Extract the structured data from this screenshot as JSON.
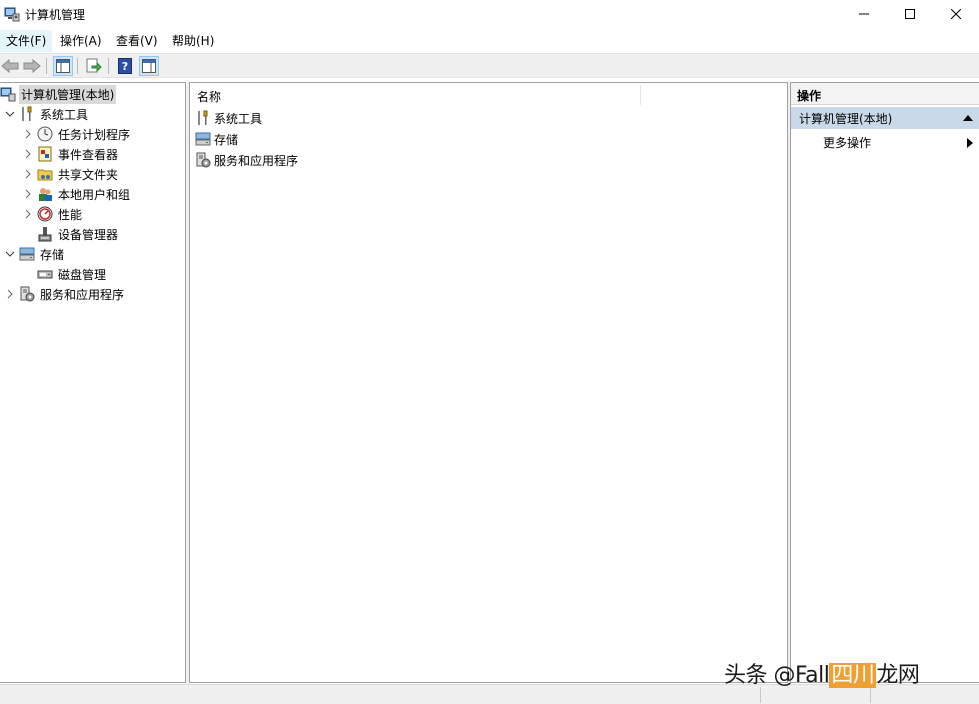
{
  "window": {
    "title": "计算机管理",
    "icon": "computer-management-icon"
  },
  "menu": [
    {
      "label": "文件(F)"
    },
    {
      "label": "操作(A)"
    },
    {
      "label": "查看(V)"
    },
    {
      "label": "帮助(H)"
    }
  ],
  "toolbar": {
    "buttons": [
      "back-icon",
      "forward-icon",
      "show-hide-tree-icon",
      "export-icon",
      "help-icon",
      "show-hide-action-pane-icon"
    ]
  },
  "tree": {
    "root": "计算机管理(本地)",
    "items": [
      {
        "label": "系统工具",
        "icon": "tools-icon"
      },
      {
        "label": "任务计划程序",
        "icon": "clock-icon"
      },
      {
        "label": "事件查看器",
        "icon": "event-viewer-icon"
      },
      {
        "label": "共享文件夹",
        "icon": "shared-folder-icon"
      },
      {
        "label": "本地用户和组",
        "icon": "users-icon"
      },
      {
        "label": "性能",
        "icon": "performance-icon"
      },
      {
        "label": "设备管理器",
        "icon": "device-manager-icon"
      },
      {
        "label": "存储",
        "icon": "storage-icon"
      },
      {
        "label": "磁盘管理",
        "icon": "disk-icon"
      },
      {
        "label": "服务和应用程序",
        "icon": "services-icon"
      }
    ]
  },
  "list": {
    "header": "名称",
    "items": [
      {
        "label": "系统工具",
        "icon": "tools-icon"
      },
      {
        "label": "存储",
        "icon": "storage-icon"
      },
      {
        "label": "服务和应用程序",
        "icon": "services-icon"
      }
    ]
  },
  "actions": {
    "header": "操作",
    "section": "计算机管理(本地)",
    "more": "更多操作"
  },
  "watermark": {
    "prefix": "头条 @Fall",
    "highlight": "四川",
    "suffix": "龙网"
  },
  "colors": {
    "selection": "#d9d9d9",
    "actions_section_bg": "#c9d9ea",
    "toolbar_bg": "#f0f0f0"
  }
}
